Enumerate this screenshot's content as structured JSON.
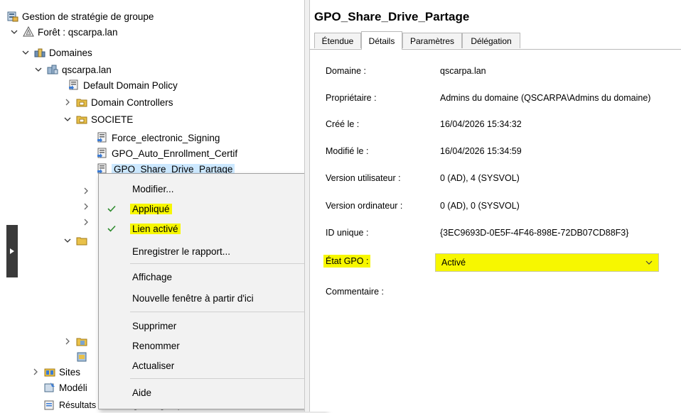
{
  "tree": {
    "items": [
      {
        "label": "Gestion de stratégie de groupe",
        "icon": "gpmc-icon"
      },
      {
        "label": "Forêt : qscarpa.lan",
        "icon": "forest-icon"
      },
      {
        "label": "Domaines",
        "icon": "domains-icon"
      },
      {
        "label": "qscarpa.lan",
        "icon": "domain-icon"
      },
      {
        "label": "Default Domain Policy",
        "icon": "gpo-link-icon"
      },
      {
        "label": "Domain Controllers",
        "icon": "ou-icon"
      },
      {
        "label": "SOCIETE",
        "icon": "ou-icon"
      },
      {
        "label": "Force_electronic_Signing",
        "icon": "gpo-link-icon"
      },
      {
        "label": "GPO_Auto_Enrollment_Certif",
        "icon": "gpo-link-icon"
      },
      {
        "label": "GPO_Share_Drive_Partage",
        "icon": "gpo-link-icon"
      },
      {
        "label": "Sites",
        "icon": "sites-icon"
      },
      {
        "label": "Modéli",
        "icon": "modeling-icon"
      },
      {
        "label": "Résultats de stratégie de groupe",
        "icon": "results-icon"
      }
    ]
  },
  "menu": {
    "modify": "Modifier...",
    "enforced": "Appliqué",
    "link_enabled": "Lien activé",
    "save_report": "Enregistrer le rapport...",
    "view": "Affichage",
    "new_window": "Nouvelle fenêtre à partir d'ici",
    "delete": "Supprimer",
    "rename": "Renommer",
    "refresh": "Actualiser",
    "help": "Aide"
  },
  "details": {
    "title": "GPO_Share_Drive_Partage",
    "tabs": [
      "Étendue",
      "Détails",
      "Paramètres",
      "Délégation"
    ],
    "active_tab": "Détails",
    "fields": {
      "domain_label": "Domaine :",
      "domain_value": "qscarpa.lan",
      "owner_label": "Propriétaire :",
      "owner_value": "Admins du domaine (QSCARPA\\Admins du domaine)",
      "created_label": "Créé le :",
      "created_value": "16/04/2026 15:34:32",
      "modified_label": "Modifié le :",
      "modified_value": "16/04/2026 15:34:59",
      "user_version_label": "Version utilisateur :",
      "user_version_value": "0 (AD), 4 (SYSVOL)",
      "computer_version_label": "Version ordinateur :",
      "computer_version_value": "0 (AD), 0 (SYSVOL)",
      "unique_id_label": "ID unique :",
      "unique_id_value": "{3EC9693D-0E5F-4F46-898E-72DB07CD88F3}",
      "gpo_status_label": "État GPO :",
      "gpo_status_value": "Activé",
      "comment_label": "Commentaire :"
    }
  },
  "colors": {
    "highlight": "#f7f700",
    "selection": "#cce8ff",
    "check": "#2e8b2e"
  }
}
